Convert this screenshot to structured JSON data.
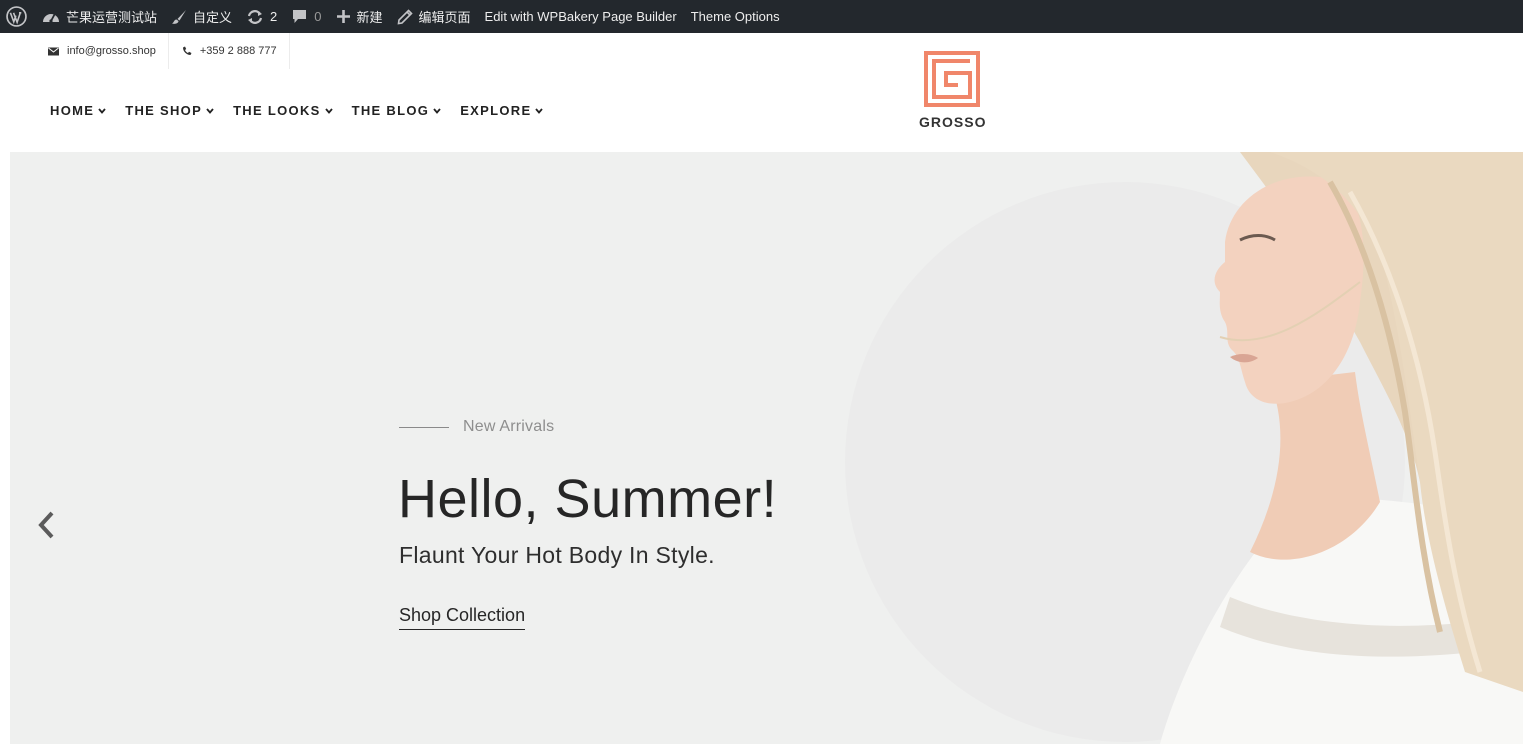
{
  "adminbar": {
    "site_name": "芒果运营测试站",
    "customize": "自定义",
    "updates_count": "2",
    "comments_count": "0",
    "new": "新建",
    "edit_page": "编辑页面",
    "wpbakery": "Edit with WPBakery Page Builder",
    "theme_options": "Theme Options"
  },
  "topbar": {
    "email": "info@grosso.shop",
    "phone": "+359 2 888 777"
  },
  "nav": {
    "items": [
      {
        "label": "HOME"
      },
      {
        "label": "THE SHOP"
      },
      {
        "label": "THE LOOKS"
      },
      {
        "label": "THE BLOG"
      },
      {
        "label": "EXPLORE"
      }
    ]
  },
  "logo": {
    "text": "GROSSO",
    "color": "#f0866a"
  },
  "hero": {
    "eyebrow": "New Arrivals",
    "title": "Hello, Summer!",
    "subtitle": "Flaunt Your Hot Body In Style.",
    "cta": "Shop Collection",
    "background": "#eff0ef"
  },
  "icons": {
    "wordpress": "wordpress-icon",
    "dashboard": "dashboard-icon",
    "brush": "brush-icon",
    "updates": "refresh-icon",
    "comments": "comment-icon",
    "plus": "plus-icon",
    "pencil": "pencil-icon",
    "email": "envelope-icon",
    "phone": "phone-icon",
    "prev": "chevron-left-icon"
  }
}
